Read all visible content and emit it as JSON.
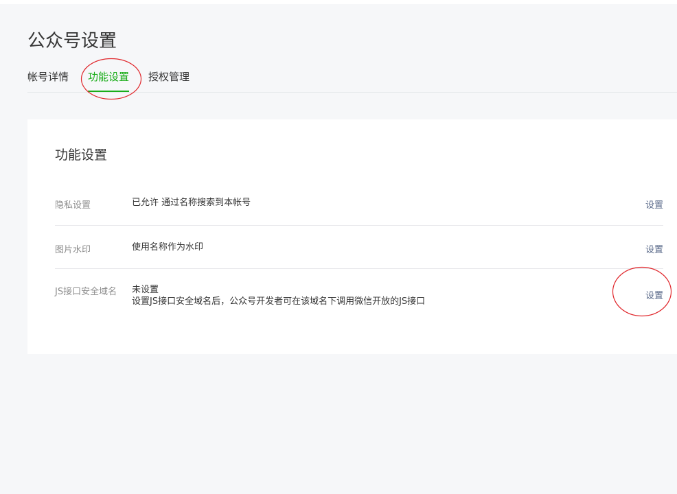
{
  "page": {
    "title": "公众号设置"
  },
  "tabs": [
    {
      "label": "帐号详情",
      "active": false
    },
    {
      "label": "功能设置",
      "active": true
    },
    {
      "label": "授权管理",
      "active": false
    }
  ],
  "card": {
    "title": "功能设置",
    "rows": [
      {
        "label": "隐私设置",
        "value": "已允许 通过名称搜索到本帐号",
        "action": "设置"
      },
      {
        "label": "图片水印",
        "value": "使用名称作为水印",
        "action": "设置"
      },
      {
        "label": "JS接口安全域名",
        "value": "未设置",
        "desc": "设置JS接口安全域名后，公众号开发者可在该域名下调用微信开放的JS接口",
        "action": "设置"
      }
    ]
  },
  "colors": {
    "accent": "#1aad19",
    "annotation": "#e0262b",
    "link": "#5a6a8a"
  }
}
